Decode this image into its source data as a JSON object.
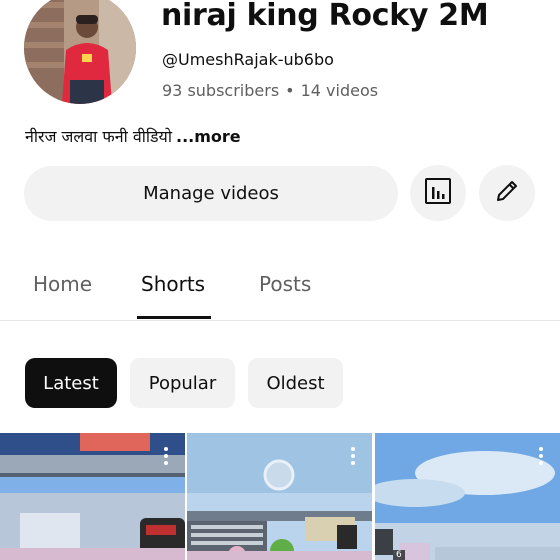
{
  "channel": {
    "name": "niraj king Rocky 2M",
    "handle": "@UmeshRajak-ub6bo",
    "subscribers": "93 subscribers",
    "separator": "•",
    "videos": "14 videos",
    "description": "नीरज जलवा फनी वीडियो",
    "more_label": "...more"
  },
  "actions": {
    "manage_label": "Manage videos",
    "analytics_icon": "bar-chart-icon",
    "edit_icon": "pencil-icon"
  },
  "tabs": [
    {
      "label": "Home",
      "active": false
    },
    {
      "label": "Shorts",
      "active": true
    },
    {
      "label": "Posts",
      "active": false
    }
  ],
  "chips": [
    {
      "label": "Latest",
      "selected": true
    },
    {
      "label": "Popular",
      "selected": false
    },
    {
      "label": "Oldest",
      "selected": false
    }
  ],
  "thumbnails": [
    {
      "menu_icon": "more-vert-icon"
    },
    {
      "menu_icon": "more-vert-icon"
    },
    {
      "menu_icon": "more-vert-icon",
      "badge": "6"
    }
  ],
  "colors": {
    "text_primary": "#0f0f0f",
    "text_secondary": "#606060",
    "chip_bg": "#f2f2f2",
    "selected_chip_bg": "#0f0f0f"
  }
}
